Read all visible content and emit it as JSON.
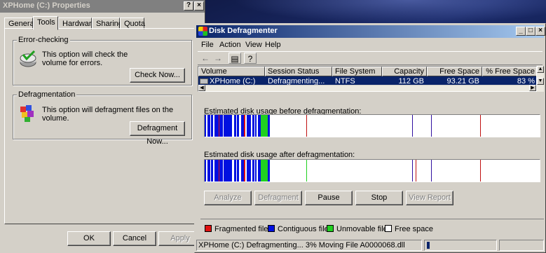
{
  "properties": {
    "title": "XPHome (C:) Properties",
    "help_btn": "?",
    "close_btn": "×",
    "tabs": [
      "General",
      "Tools",
      "Hardware",
      "Sharing",
      "Quota"
    ],
    "error_checking": {
      "label": "Error-checking",
      "text": "This option will check the volume for errors.",
      "button": "Check Now..."
    },
    "defragmentation": {
      "label": "Defragmentation",
      "text": "This option will defragment files on the volume.",
      "button": "Defragment Now..."
    },
    "footer": {
      "ok": "OK",
      "cancel": "Cancel",
      "apply": "Apply"
    }
  },
  "defrag": {
    "title": "Disk Defragmenter",
    "window_buttons": {
      "min": "_",
      "max": "□",
      "close": "×"
    },
    "menus": [
      "File",
      "Action",
      "View",
      "Help"
    ],
    "toolbar_icons": [
      "back-icon",
      "forward-icon",
      "properties-icon",
      "help-icon"
    ],
    "columns": [
      "Volume",
      "Session Status",
      "File System",
      "Capacity",
      "Free Space",
      "% Free Space"
    ],
    "row": {
      "volume": "XPHome (C:)",
      "status": "Defragmenting...",
      "fs": "NTFS",
      "capacity": "112 GB",
      "free": "93.21 GB",
      "pct_free": "83 %"
    },
    "before_label": "Estimated disk usage before defragmentation:",
    "after_label": "Estimated disk usage after defragmentation:",
    "buttons": {
      "analyze": "Analyze",
      "defragment": "Defragment",
      "pause": "Pause",
      "stop": "Stop",
      "view_report": "View Report"
    },
    "legend": [
      {
        "label": "Fragmented files",
        "color": "#e01010"
      },
      {
        "label": "Contiguous files",
        "color": "#0010e0"
      },
      {
        "label": "Unmovable files",
        "color": "#20d020"
      },
      {
        "label": "Free space",
        "color": "#ffffff"
      }
    ],
    "status_text": "XPHome (C:) Defragmenting... 3%  Moving File A0000068.dll",
    "progress_fraction": 0.03
  }
}
